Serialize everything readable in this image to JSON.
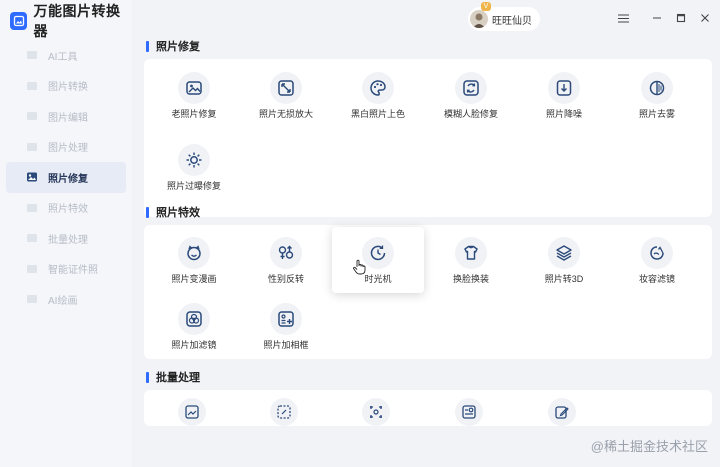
{
  "app": {
    "title": "万能图片转换器"
  },
  "sidebar": {
    "items": [
      {
        "label": "AI工具",
        "active": false
      },
      {
        "label": "图片转换",
        "active": false
      },
      {
        "label": "图片编辑",
        "active": false
      },
      {
        "label": "图片处理",
        "active": false
      },
      {
        "label": "照片修复",
        "active": true
      },
      {
        "label": "照片特效",
        "active": false
      },
      {
        "label": "批量处理",
        "active": false
      },
      {
        "label": "智能证件照",
        "active": false
      },
      {
        "label": "AI绘画",
        "active": false
      }
    ]
  },
  "user": {
    "name": "旺旺仙贝",
    "badge": "V"
  },
  "sections": [
    {
      "title": "照片修复",
      "tools": [
        {
          "label": "老照片修复",
          "icon": "old-photo-icon"
        },
        {
          "label": "照片无损放大",
          "icon": "expand-icon"
        },
        {
          "label": "黑白照片上色",
          "icon": "palette-icon"
        },
        {
          "label": "模糊人脸修复",
          "icon": "face-fix-icon"
        },
        {
          "label": "照片降噪",
          "icon": "denoise-icon"
        },
        {
          "label": "照片去雾",
          "icon": "dehaze-icon"
        },
        {
          "label": "照片过曝修复",
          "icon": "exposure-icon"
        }
      ]
    },
    {
      "title": "照片特效",
      "tools": [
        {
          "label": "照片变漫画",
          "icon": "cartoon-icon"
        },
        {
          "label": "性别反转",
          "icon": "gender-icon"
        },
        {
          "label": "时光机",
          "icon": "clock-icon"
        },
        {
          "label": "换脸换装",
          "icon": "outfit-icon"
        },
        {
          "label": "照片转3D",
          "icon": "layers-icon"
        },
        {
          "label": "妆容滤镜",
          "icon": "makeup-icon"
        },
        {
          "label": "照片加滤镜",
          "icon": "filter-icon"
        },
        {
          "label": "照片加相框",
          "icon": "frame-icon"
        }
      ]
    },
    {
      "title": "批量处理",
      "tools": []
    }
  ],
  "watermark": "@稀土掘金技术社区",
  "colors": {
    "accent": "#2f6bff",
    "icon": "#2b4a7a"
  }
}
